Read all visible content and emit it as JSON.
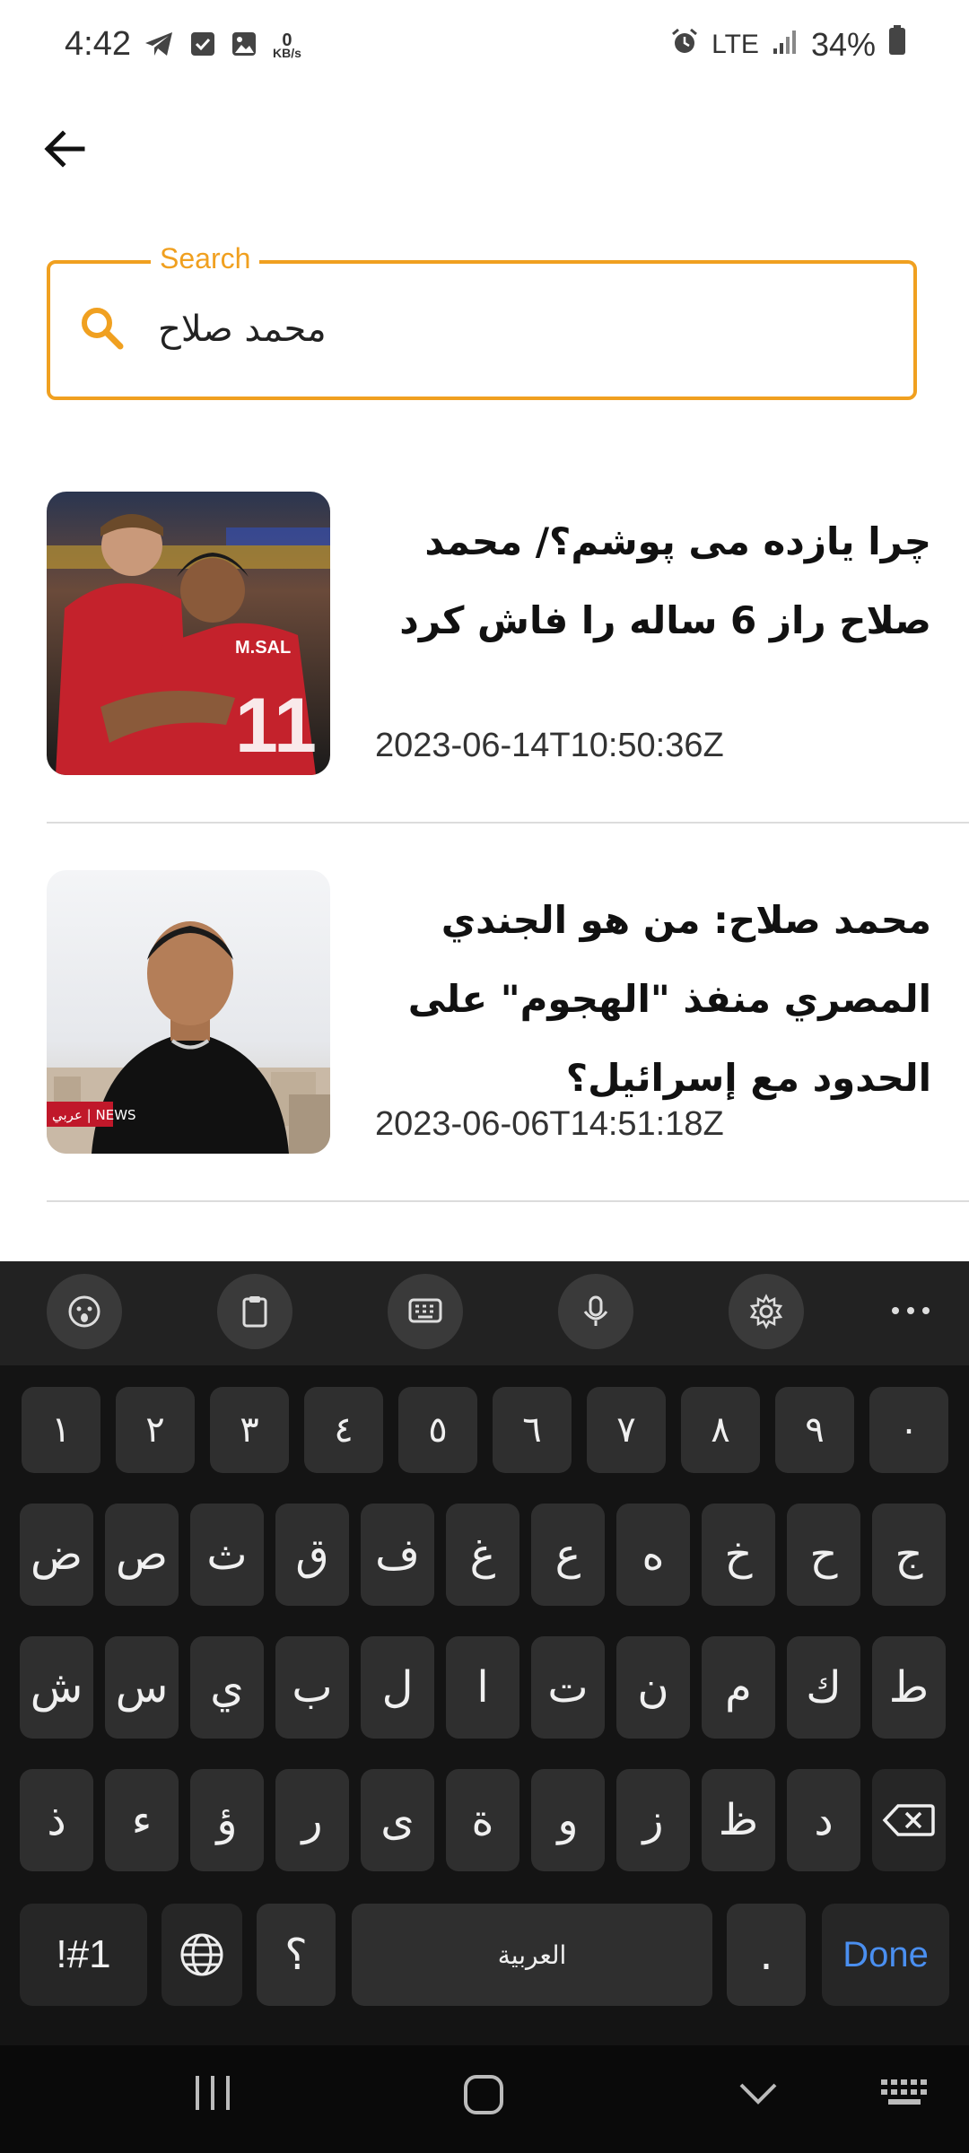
{
  "status_bar": {
    "time": "4:42",
    "speed_value": "0",
    "speed_unit": "KB/s",
    "network": "LTE",
    "battery": "34%"
  },
  "search": {
    "label": "Search",
    "value": "محمد صلاح"
  },
  "results": [
    {
      "title": "چرا یازده می پوشم؟/ محمد صلاح راز 6 ساله را فاش کرد",
      "date": "2023-06-14T10:50:36Z",
      "thumb_jersey": "M.SAL",
      "thumb_number": "11"
    },
    {
      "title": "محمد صلاح: من هو الجندي المصري منفذ \"الهجوم\" على الحدود مع إسرائيل؟",
      "date": "2023-06-06T14:51:18Z",
      "thumb_badge": "عربي | NEWS"
    }
  ],
  "keyboard": {
    "row_numbers": [
      "١",
      "٢",
      "٣",
      "٤",
      "٥",
      "٦",
      "٧",
      "٨",
      "٩",
      "٠"
    ],
    "row1": [
      "ض",
      "ص",
      "ث",
      "ق",
      "ف",
      "غ",
      "ع",
      "ه",
      "خ",
      "ح",
      "ج"
    ],
    "row2": [
      "ش",
      "س",
      "ي",
      "ب",
      "ل",
      "ا",
      "ت",
      "ن",
      "م",
      "ك",
      "ط"
    ],
    "row3": [
      "ذ",
      "ء",
      "ؤ",
      "ر",
      "ى",
      "ة",
      "و",
      "ز",
      "ظ",
      "د"
    ],
    "symbols_label": "!#1",
    "question_label": "؟",
    "space_label": "العربية",
    "period_label": ".",
    "done_label": "Done"
  },
  "colors": {
    "accent": "#f0a020",
    "keyboard_bg": "#141414",
    "done_text": "#4a8ff0"
  }
}
